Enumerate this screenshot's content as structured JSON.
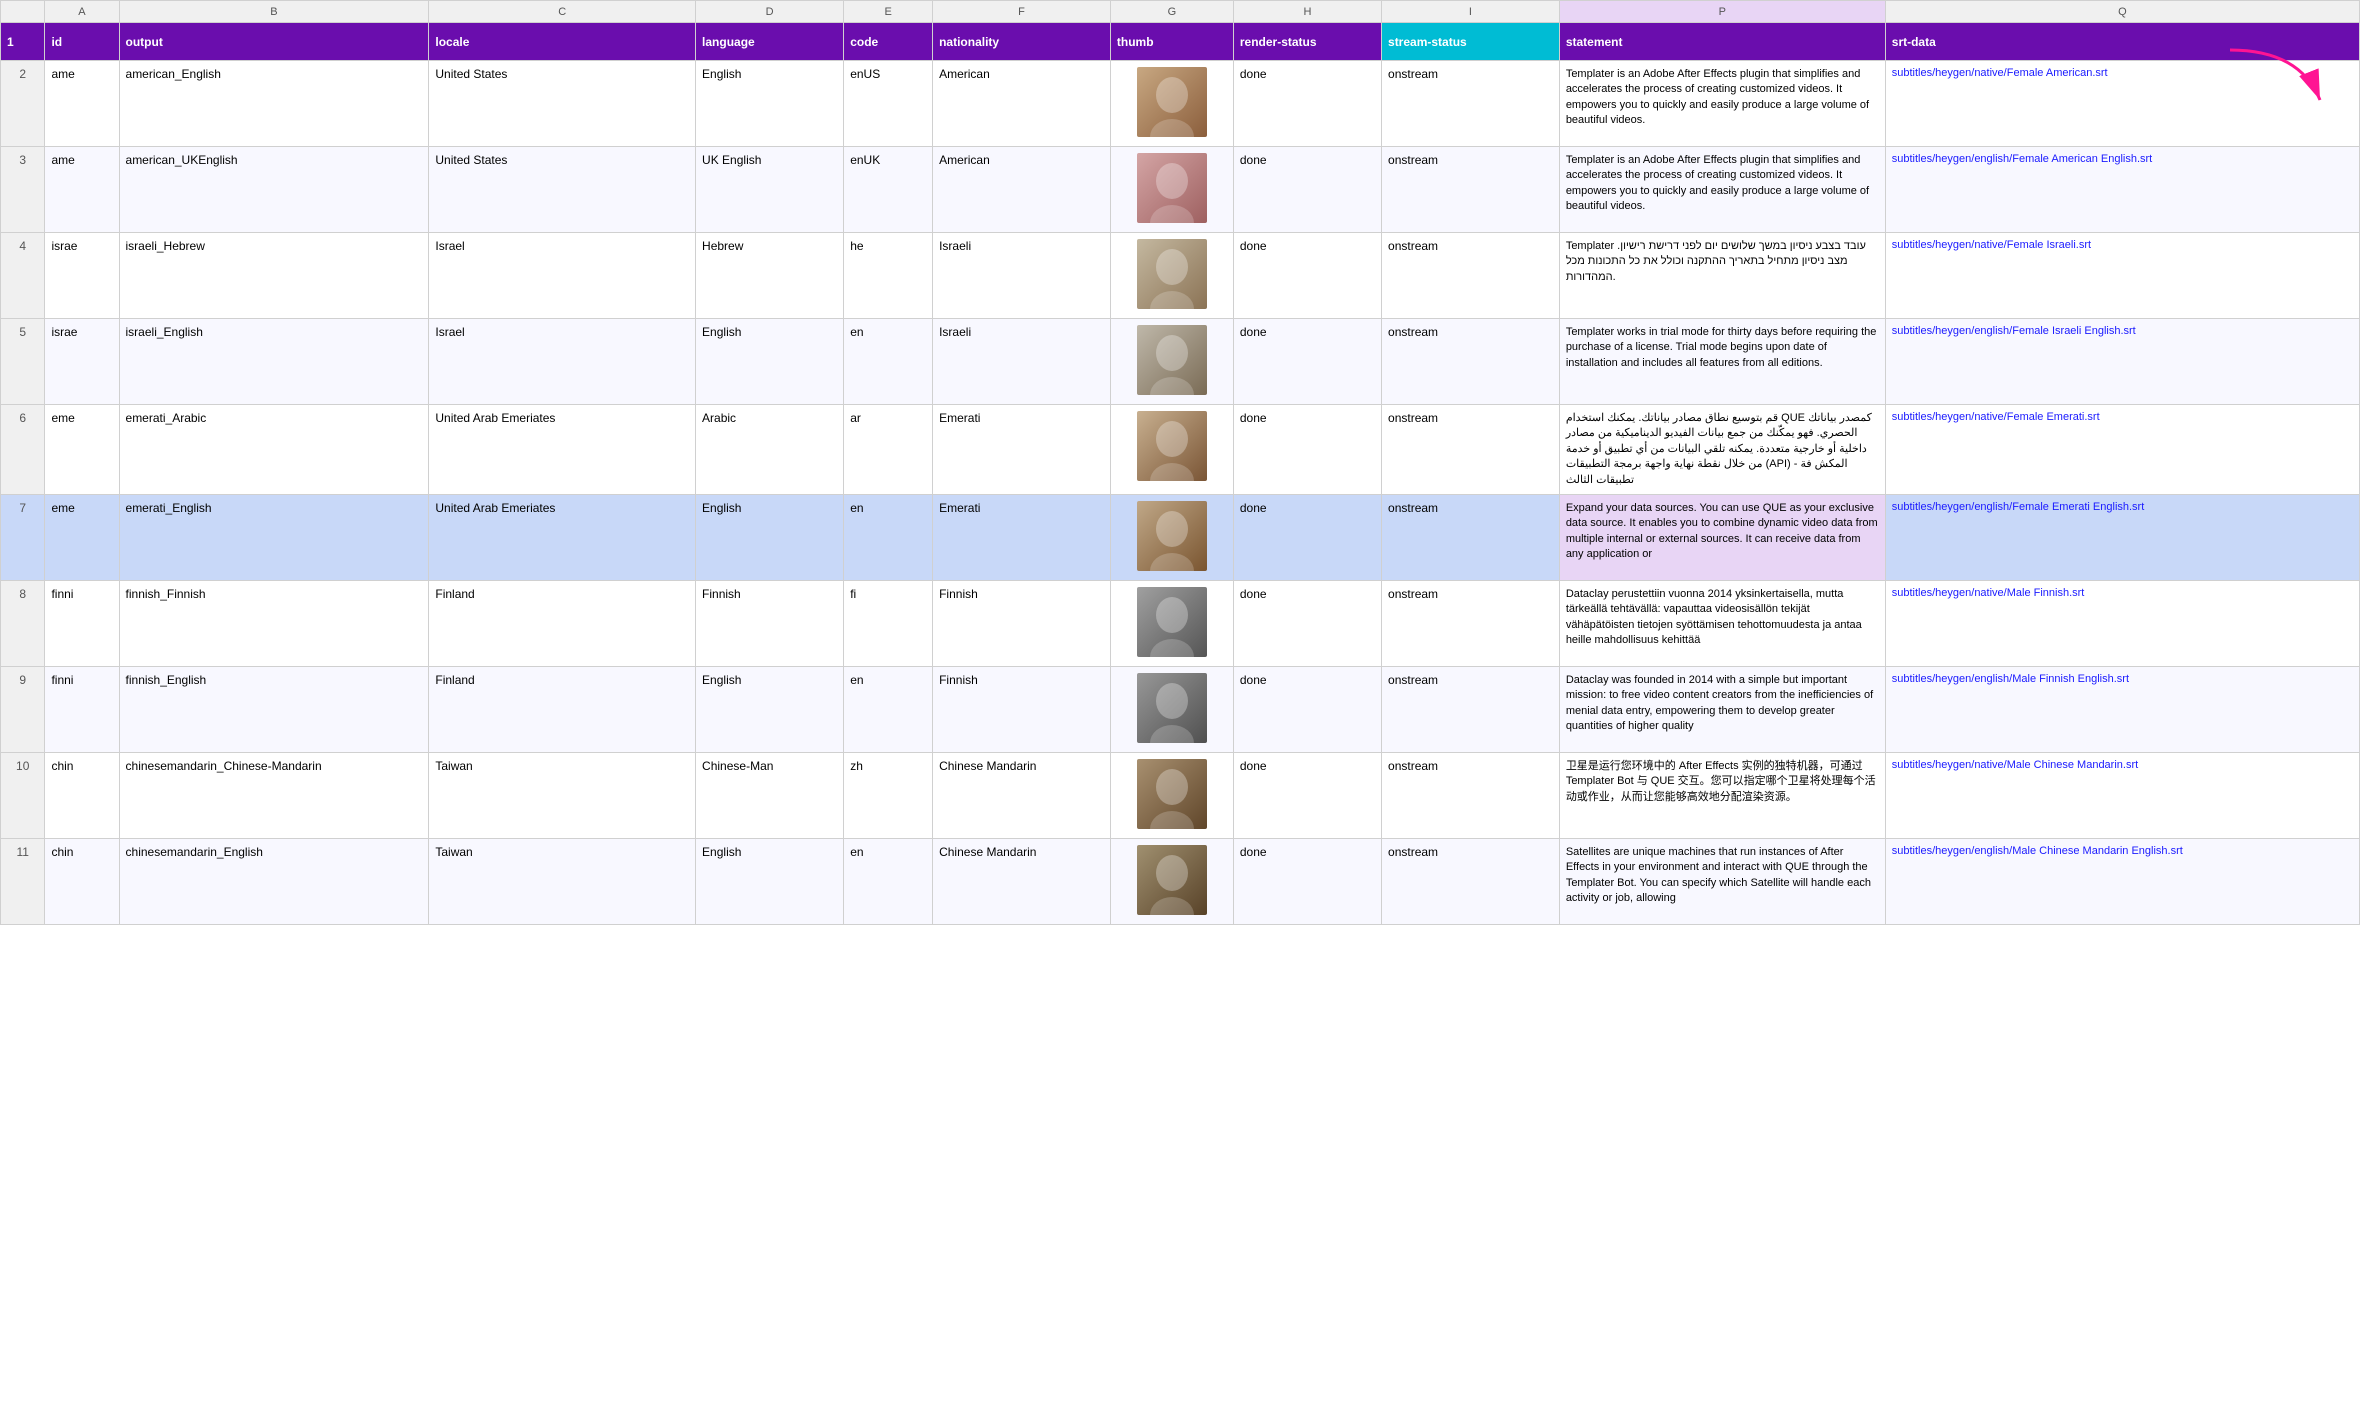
{
  "columns": {
    "letters": [
      "",
      "A",
      "B",
      "C",
      "D",
      "E",
      "F",
      "G",
      "H",
      "I",
      "P",
      "Q"
    ],
    "headers": [
      "",
      "id",
      "output",
      "locale",
      "language",
      "code",
      "nationality",
      "thumb",
      "render-status",
      "stream-status",
      "statement",
      "srt-data"
    ]
  },
  "rows": [
    {
      "num": 2,
      "a": "ame",
      "b": "american_English",
      "c": "United States",
      "d": "English",
      "e": "enUS",
      "f": "American",
      "g": "thumb",
      "h": "done",
      "i": "onstream",
      "avatar_class": "avatar-female-american",
      "statement": "Templater is an Adobe After Effects plugin that simplifies and accelerates the process of creating customized videos. It empowers you to quickly and easily produce a large volume of beautiful videos.",
      "srt": "subtitles/heygen/native/Female American.srt"
    },
    {
      "num": 3,
      "a": "ame",
      "b": "american_UKEnglish",
      "c": "United States",
      "d": "UK English",
      "e": "enUK",
      "f": "American",
      "g": "thumb",
      "h": "done",
      "i": "onstream",
      "avatar_class": "avatar-female-american2",
      "statement": "Templater is an Adobe After Effects plugin that simplifies and accelerates the process of creating customized videos. It empowers you to quickly and easily produce a large volume of beautiful videos.",
      "srt": "subtitles/heygen/english/Female American English.srt"
    },
    {
      "num": 4,
      "a": "israe",
      "b": "israeli_Hebrew",
      "c": "Israel",
      "d": "Hebrew",
      "e": "he",
      "f": "Israeli",
      "g": "thumb",
      "h": "done",
      "i": "onstream",
      "avatar_class": "avatar-female-israeli",
      "statement": "Templater עובד בצבע ניסיון במשך שלושים יום לפני דרישת רישיון. מצב ניסיון מתחיל בתאריך ההתקנה וכולל את כל התכונות מכל המהדורות.",
      "srt": "subtitles/heygen/native/Female Israeli.srt"
    },
    {
      "num": 5,
      "a": "israe",
      "b": "israeli_English",
      "c": "Israel",
      "d": "English",
      "e": "en",
      "f": "Israeli",
      "g": "thumb",
      "h": "done",
      "i": "onstream",
      "avatar_class": "avatar-female-israeli2",
      "statement": "Templater works in trial mode for thirty days before requiring the purchase of a license. Trial mode begins upon date of installation and includes all features from all editions.",
      "srt": "subtitles/heygen/english/Female Israeli English.srt"
    },
    {
      "num": 6,
      "a": "eme",
      "b": "emerati_Arabic",
      "c": "United Arab Emeriates",
      "d": "Arabic",
      "e": "ar",
      "f": "Emerati",
      "g": "thumb",
      "h": "done",
      "i": "onstream",
      "avatar_class": "avatar-female-emerati",
      "statement": "قم بتوسيع نطاق مصادر بياناتك. يمكنك استخدام QUE كمصدر بياناتك الحصري. فهو يمكّنك من جمع بيانات الفيديو الديناميكية من مصادر داخلية أو خارجية متعددة. يمكنه تلقي البيانات من أي تطبيق أو خدمة من خلال نقطة نهاية واجهة برمجة التطبيقات (API) المكش فة - تطبيقات الثالث",
      "srt": "subtitles/heygen/native/Female Emerati.srt"
    },
    {
      "num": 7,
      "a": "eme",
      "b": "emerati_English",
      "c": "United Arab Emeriates",
      "d": "English",
      "e": "en",
      "f": "Emerati",
      "g": "thumb",
      "h": "done",
      "i": "onstream",
      "avatar_class": "avatar-female-emerati2",
      "statement": "Expand your data sources. You can use QUE as your exclusive data source. It enables you to combine dynamic video data from multiple internal or external sources. It can receive data from any application or",
      "srt": "subtitles/heygen/english/Female Emerati English.srt",
      "selected": true
    },
    {
      "num": 8,
      "a": "finni",
      "b": "finnish_Finnish",
      "c": "Finland",
      "d": "Finnish",
      "e": "fi",
      "f": "Finnish",
      "g": "thumb",
      "h": "done",
      "i": "onstream",
      "avatar_class": "avatar-male-finnish",
      "statement": "Dataclay perustettiin vuonna 2014 yksinkertaisella, mutta tärkeällä tehtävällä: vapauttaa videosisällön tekijät vähäpätöisten tietojen syöttämisen tehottomuudesta ja antaa heille mahdollisuus kehittää",
      "srt": "subtitles/heygen/native/Male Finnish.srt"
    },
    {
      "num": 9,
      "a": "finni",
      "b": "finnish_English",
      "c": "Finland",
      "d": "English",
      "e": "en",
      "f": "Finnish",
      "g": "thumb",
      "h": "done",
      "i": "onstream",
      "avatar_class": "avatar-male-finnish2",
      "statement": "Dataclay was founded in 2014 with a simple but important mission: to free video content creators from the inefficiencies of menial data entry, empowering them to develop greater quantities of higher quality",
      "srt": "subtitles/heygen/english/Male Finnish English.srt"
    },
    {
      "num": 10,
      "a": "chin",
      "b": "chinesemandarin_Chinese-Mandarin",
      "c": "Taiwan",
      "d": "Chinese-Man",
      "e": "zh",
      "f": "Chinese Mandarin",
      "g": "thumb",
      "h": "done",
      "i": "onstream",
      "avatar_class": "avatar-male-chinese",
      "statement": "卫星是运行您环境中的 After Effects 实例的独特机器，可通过 Templater Bot 与 QUE 交互。您可以指定哪个卫星将处理每个活动或作业，从而让您能够高效地分配渲染资源。",
      "srt": "subtitles/heygen/native/Male Chinese Mandarin.srt"
    },
    {
      "num": 11,
      "a": "chin",
      "b": "chinesemandarin_English",
      "c": "Taiwan",
      "d": "English",
      "e": "en",
      "f": "Chinese Mandarin",
      "g": "thumb",
      "h": "done",
      "i": "onstream",
      "avatar_class": "avatar-male-chinese2",
      "statement": "Satellites are unique machines that run instances of After Effects in your environment and interact with QUE through the Templater Bot. You can specify which Satellite will handle each activity or job, allowing",
      "srt": "subtitles/heygen/english/Male Chinese Mandarin English.srt"
    }
  ],
  "ui": {
    "arrow_color": "#ff1493"
  }
}
